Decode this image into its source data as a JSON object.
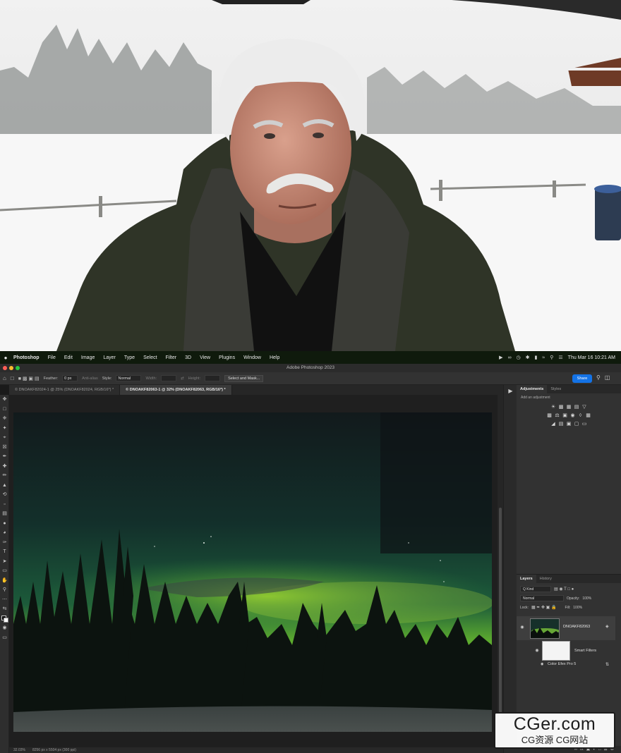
{
  "menubar": {
    "app": "Photoshop",
    "items": [
      "File",
      "Edit",
      "Image",
      "Layer",
      "Type",
      "Select",
      "Filter",
      "3D",
      "View",
      "Plugins",
      "Window",
      "Help"
    ],
    "datetime": "Thu Mar 16  10:21 AM"
  },
  "window": {
    "title": "Adobe Photoshop 2023"
  },
  "options": {
    "feather_label": "Feather:",
    "feather_value": "0 px",
    "antialias_label": "Anti-alias",
    "style_label": "Style:",
    "style_value": "Normal",
    "width_label": "Width:",
    "height_label": "Height:",
    "select_mask_label": "Select and Mask...",
    "share_label": "Share"
  },
  "tabs": [
    {
      "label": "© DNOAKF82024-1 @ 25% (DNOAKF82024, RGB/16*) *",
      "active": false
    },
    {
      "label": "© DNOAKF82063-1 @ 32% (DNOAKF82063, RGB/16*) *",
      "active": true
    }
  ],
  "status": {
    "zoom": "32.03%",
    "dims": "8256 px x 5504 px (300 ppi)"
  },
  "adjustments": {
    "tabs": [
      "Adjustments",
      "Styles"
    ],
    "hint": "Add an adjustment"
  },
  "layers": {
    "tabs": [
      "Layers",
      "History"
    ],
    "kind": "Q Kind",
    "blend": "Normal",
    "opacity_label": "Opacity:",
    "opacity": "100%",
    "lock_label": "Lock:",
    "fill_label": "Fill:",
    "fill": "100%",
    "layer_name": "DNOAKF82063",
    "smart_filters": "Smart Filters",
    "filter_name": "Color Efex Pro 5"
  },
  "watermark": {
    "main": "CGer.com",
    "sub": "CG资源 CG网站"
  },
  "colors": {
    "accent": "#1473e6",
    "menubar": "#0f1a0c",
    "panel": "#323232"
  }
}
